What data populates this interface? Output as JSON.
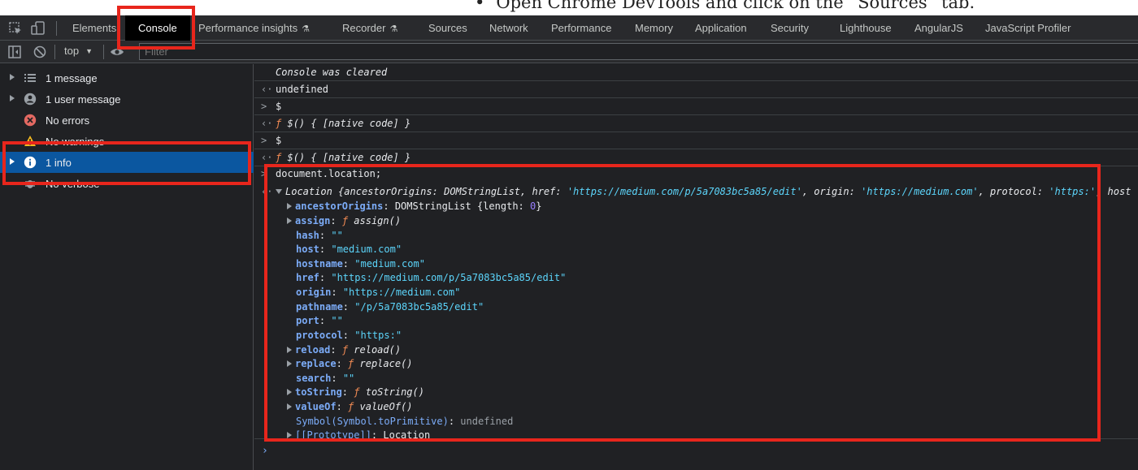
{
  "article": {
    "bullet": "•",
    "text": "Open Chrome DevTools and click on the “Sources” tab."
  },
  "tabs": [
    {
      "label": "Elements",
      "experimental": false
    },
    {
      "label": "Console",
      "experimental": false,
      "active": true
    },
    {
      "label": "Performance insights",
      "experimental": true
    },
    {
      "label": "Recorder",
      "experimental": true
    },
    {
      "label": "Sources",
      "experimental": false
    },
    {
      "label": "Network",
      "experimental": false
    },
    {
      "label": "Performance",
      "experimental": false
    },
    {
      "label": "Memory",
      "experimental": false
    },
    {
      "label": "Application",
      "experimental": false
    },
    {
      "label": "Security",
      "experimental": false
    },
    {
      "label": "Lighthouse",
      "experimental": false
    },
    {
      "label": "AngularJS",
      "experimental": false
    },
    {
      "label": "JavaScript Profiler",
      "experimental": false
    }
  ],
  "icons": {
    "inspect": "element-picker-icon",
    "device": "device-toolbar-icon",
    "sidebar": "sidebar-toggle-icon",
    "clear": "clear-console-icon",
    "eye": "live-expression-eye-icon",
    "flask": "⚗"
  },
  "toolbar": {
    "context": "top",
    "filter_placeholder": "Filter"
  },
  "sidebar": {
    "items": [
      {
        "label": "1 message",
        "icon": "list-icon"
      },
      {
        "label": "1 user message",
        "icon": "user-icon"
      },
      {
        "label": "No errors",
        "icon": "error-icon"
      },
      {
        "label": "No warnings",
        "icon": "warning-icon"
      },
      {
        "label": "1 info",
        "icon": "info-icon",
        "selected": true
      },
      {
        "label": "No verbose",
        "icon": "verbose-icon"
      }
    ]
  },
  "console": {
    "cleared": "Console was cleared",
    "undefined": "undefined",
    "dollar": "$",
    "dollar_result_f": "ƒ",
    "dollar_result": "$() { [native code] }",
    "input_expr_a": "document.",
    "input_expr_b": "location",
    "input_expr_c": ";",
    "location_summary": {
      "name": "Location",
      "open": "{",
      "ancestor_key": "ancestorOrigins",
      "ancestor_val": "DOMStringList",
      "href_key": "href",
      "href_val": "'https://medium.com/p/5a7083bc5a85/edit'",
      "origin_key": "origin",
      "origin_val": "'https://medium.com'",
      "protocol_key": "protocol",
      "protocol_val": "'https:'",
      "tail": "host"
    },
    "props": [
      {
        "key": "ancestorOrigins",
        "expandable": true,
        "val_plain": "DOMStringList {length: ",
        "val_num": "0",
        "val_end": "}"
      },
      {
        "key": "assign",
        "expandable": true,
        "fn": "assign()"
      },
      {
        "key": "hash",
        "str": "\"\""
      },
      {
        "key": "host",
        "str": "\"medium.com\""
      },
      {
        "key": "hostname",
        "str": "\"medium.com\""
      },
      {
        "key": "href",
        "str": "\"https://medium.com/p/5a7083bc5a85/edit\""
      },
      {
        "key": "origin",
        "str": "\"https://medium.com\""
      },
      {
        "key": "pathname",
        "str": "\"/p/5a7083bc5a85/edit\""
      },
      {
        "key": "port",
        "str": "\"\""
      },
      {
        "key": "protocol",
        "str": "\"https:\""
      },
      {
        "key": "reload",
        "expandable": true,
        "fn": "reload()"
      },
      {
        "key": "replace",
        "expandable": true,
        "fn": "replace()"
      },
      {
        "key": "search",
        "str": "\"\""
      },
      {
        "key": "toString",
        "expandable": true,
        "fn": "toString()"
      },
      {
        "key": "valueOf",
        "expandable": true,
        "fn": "valueOf()"
      },
      {
        "key": "Symbol(Symbol.toPrimitive)",
        "dim": true,
        "val_plain": "undefined"
      },
      {
        "key": "[[Prototype]]",
        "expandable": true,
        "dim": true,
        "val_plain": "Location"
      }
    ]
  },
  "colors": {
    "highlight": "#e8261c",
    "selected": "#0b57a0",
    "accent": "#7cacf8"
  }
}
